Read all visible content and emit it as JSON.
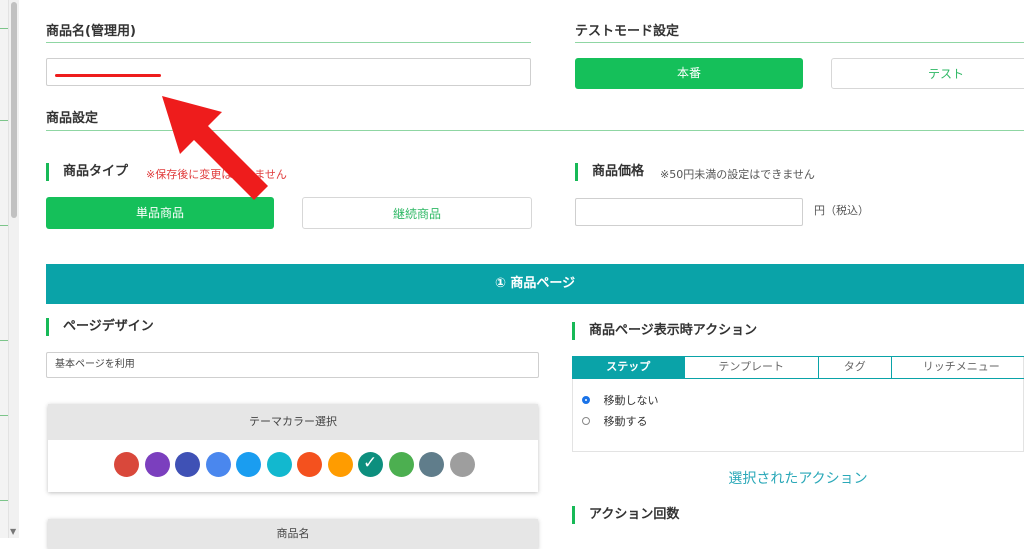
{
  "product_name": {
    "title": "商品名(管理用)",
    "value": ""
  },
  "test_mode": {
    "title": "テストモード設定",
    "production_label": "本番",
    "test_label": "テスト"
  },
  "product_settings": {
    "title": "商品設定"
  },
  "product_type": {
    "label": "商品タイプ",
    "note": "※保存後に変更はできません",
    "single_label": "単品商品",
    "recurring_label": "継続商品"
  },
  "product_price": {
    "label": "商品価格",
    "note": "※50円未満の設定はできません",
    "value": "",
    "unit": "円（税込）"
  },
  "product_page_bar": {
    "label": "① 商品ページ"
  },
  "page_design": {
    "label": "ページデザイン",
    "selected": "基本ページを利用"
  },
  "theme_color": {
    "title": "テーマカラー選択",
    "colors": [
      "#d9483b",
      "#7b3fbe",
      "#3f51b5",
      "#4a87ee",
      "#1a9df0",
      "#12b8cf",
      "#f4511e",
      "#ff9c00",
      "#0d8f7e",
      "#4caf50",
      "#607d8b",
      "#9e9e9e"
    ],
    "selected_index": 8
  },
  "next_card": {
    "title": "商品名"
  },
  "page_action": {
    "label": "商品ページ表示時アクション",
    "tabs": [
      "ステップ",
      "テンプレート",
      "タグ",
      "リッチメニュー"
    ],
    "active_tab": 0,
    "options": [
      "移動しない",
      "移動する"
    ],
    "selected_option": 0,
    "selected_action_link": "選択されたアクション"
  },
  "action_count": {
    "label": "アクション回数"
  },
  "annotation": {
    "arrow_color": "#ee1c1c",
    "underline_color": "#ee1c1c"
  }
}
